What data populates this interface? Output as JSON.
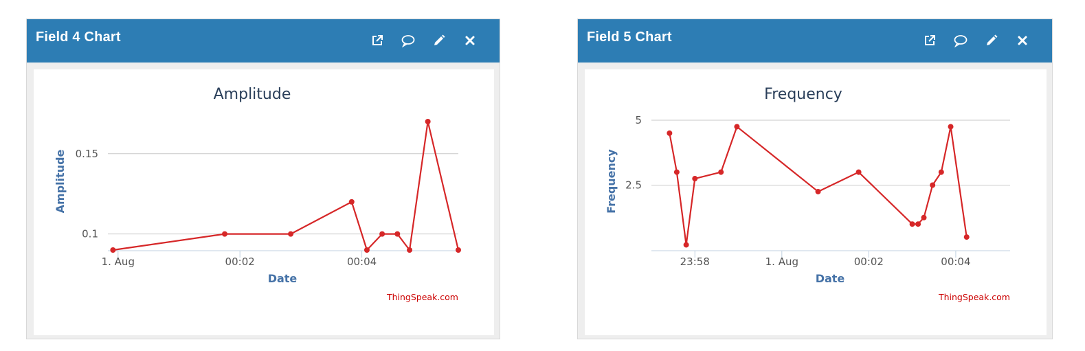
{
  "panels": [
    {
      "title": "Field 4 Chart",
      "tools": [
        "external-link-icon",
        "comment-icon",
        "pencil-icon",
        "close-icon"
      ]
    },
    {
      "title": "Field 5 Chart",
      "tools": [
        "external-link-icon",
        "comment-icon",
        "pencil-icon",
        "close-icon"
      ]
    }
  ],
  "credit": "ThingSpeak.com",
  "colors": {
    "header": "#2d7db4",
    "series": "#d62728",
    "axis_title": "#4572a7",
    "credit": "#cc0000"
  },
  "chart_data": [
    {
      "type": "line",
      "title": "Amplitude",
      "xlabel": "Date",
      "ylabel": "Amplitude",
      "ylim": [
        0.09,
        0.17
      ],
      "yticks": [
        0.1,
        0.15
      ],
      "ytick_labels": [
        "0.1",
        "0.15"
      ],
      "xlim": [
        "2017-07-31T23:59:50",
        "2017-08-01T00:05:35"
      ],
      "xticks": [
        "2017-08-01T00:00",
        "2017-08-01T00:02",
        "2017-08-01T00:04"
      ],
      "xtick_labels": [
        "1. Aug",
        "00:02",
        "00:04"
      ],
      "grid": true,
      "legend": false,
      "series": [
        {
          "x": [
            "2017-07-31T23:59:55",
            "2017-08-01T00:01:45",
            "2017-08-01T00:02:50",
            "2017-08-01T00:03:50",
            "2017-08-01T00:04:05",
            "2017-08-01T00:04:20",
            "2017-08-01T00:04:35",
            "2017-08-01T00:04:47",
            "2017-08-01T00:05:05",
            "2017-08-01T00:05:35"
          ],
          "y": [
            0.09,
            0.1,
            0.1,
            0.12,
            0.09,
            0.1,
            0.1,
            0.09,
            0.17,
            0.09
          ]
        }
      ]
    },
    {
      "type": "line",
      "title": "Frequency",
      "xlabel": "Date",
      "ylabel": "Frequency",
      "ylim": [
        0,
        5
      ],
      "yticks": [
        2.5,
        5
      ],
      "ytick_labels": [
        "2.5",
        "5"
      ],
      "xlim": [
        "2017-07-31T23:57:00",
        "2017-08-01T00:05:15"
      ],
      "xticks": [
        "2017-07-31T23:58",
        "2017-08-01T00:00",
        "2017-08-01T00:02",
        "2017-08-01T00:04"
      ],
      "xtick_labels": [
        "23:58",
        "1. Aug",
        "00:02",
        "00:04"
      ],
      "grid": true,
      "legend": false,
      "series": [
        {
          "x": [
            "2017-07-31T23:57:25",
            "2017-07-31T23:57:35",
            "2017-07-31T23:57:48",
            "2017-07-31T23:58:00",
            "2017-07-31T23:58:36",
            "2017-07-31T23:58:58",
            "2017-08-01T00:00:50",
            "2017-08-01T00:01:46",
            "2017-08-01T00:03:00",
            "2017-08-01T00:03:08",
            "2017-08-01T00:03:16",
            "2017-08-01T00:03:28",
            "2017-08-01T00:03:40",
            "2017-08-01T00:03:53",
            "2017-08-01T00:04:15"
          ],
          "y": [
            4.5,
            3.0,
            0.2,
            2.75,
            3.0,
            4.75,
            2.25,
            3.0,
            1.0,
            1.0,
            1.25,
            2.5,
            3.0,
            4.75,
            0.5
          ]
        }
      ]
    }
  ]
}
